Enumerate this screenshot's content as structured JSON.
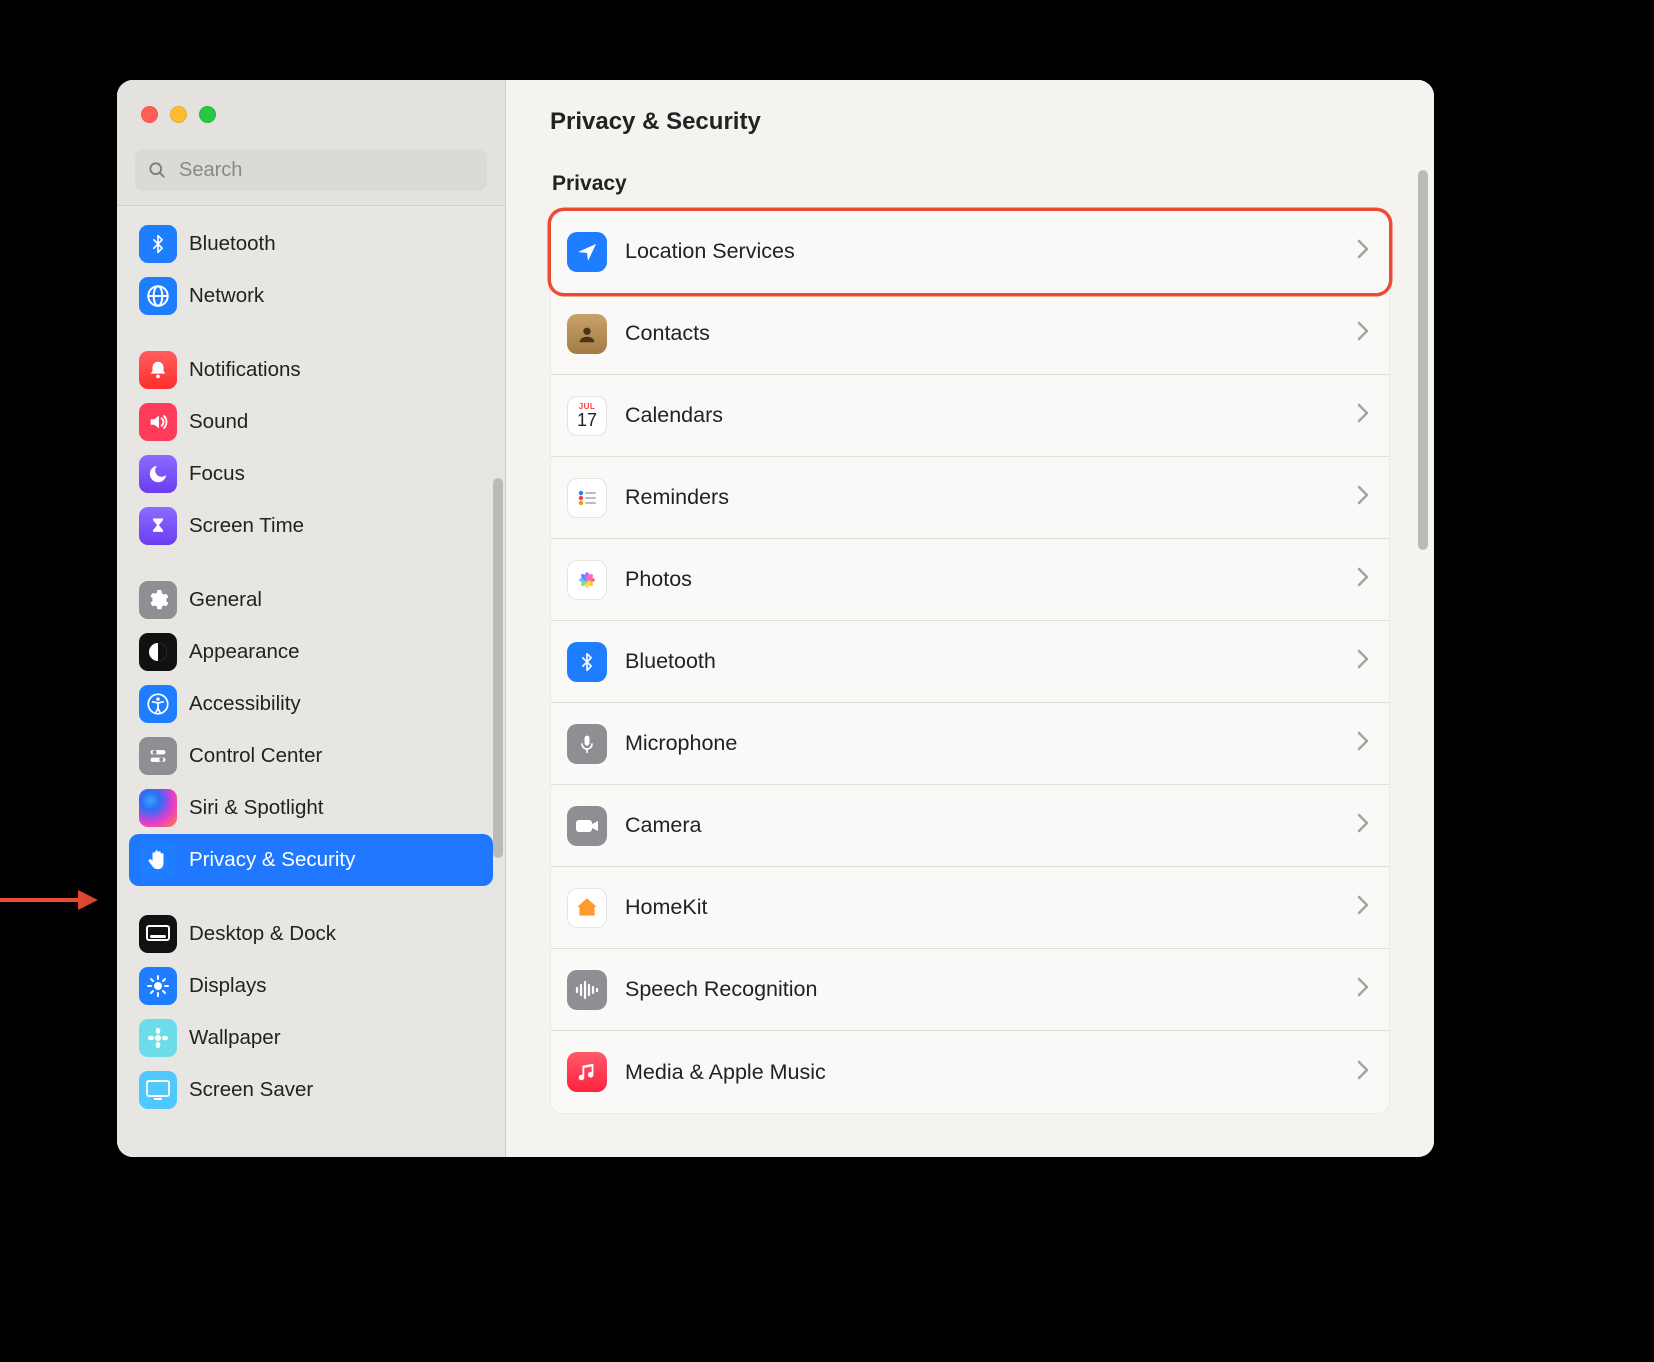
{
  "search": {
    "placeholder": "Search"
  },
  "sidebar": {
    "group0": [
      {
        "label": "Bluetooth"
      },
      {
        "label": "Network"
      }
    ],
    "group1": [
      {
        "label": "Notifications"
      },
      {
        "label": "Sound"
      },
      {
        "label": "Focus"
      },
      {
        "label": "Screen Time"
      }
    ],
    "group2": [
      {
        "label": "General"
      },
      {
        "label": "Appearance"
      },
      {
        "label": "Accessibility"
      },
      {
        "label": "Control Center"
      },
      {
        "label": "Siri & Spotlight"
      },
      {
        "label": "Privacy & Security"
      }
    ],
    "group3": [
      {
        "label": "Desktop & Dock"
      },
      {
        "label": "Displays"
      },
      {
        "label": "Wallpaper"
      },
      {
        "label": "Screen Saver"
      }
    ]
  },
  "content": {
    "title": "Privacy & Security",
    "section": "Privacy",
    "rows": [
      {
        "label": "Location Services"
      },
      {
        "label": "Contacts"
      },
      {
        "label": "Calendars"
      },
      {
        "label": "Reminders"
      },
      {
        "label": "Photos"
      },
      {
        "label": "Bluetooth"
      },
      {
        "label": "Microphone"
      },
      {
        "label": "Camera"
      },
      {
        "label": "HomeKit"
      },
      {
        "label": "Speech Recognition"
      },
      {
        "label": "Media & Apple Music"
      }
    ],
    "calendar_day": "17",
    "calendar_month": "JUL"
  }
}
